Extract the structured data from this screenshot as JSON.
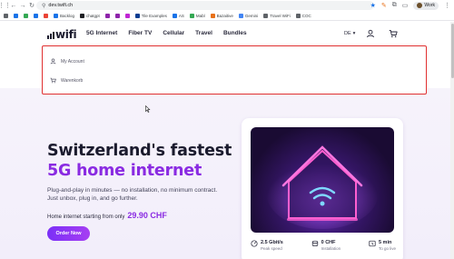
{
  "browser": {
    "url": "dev.twifi.ch",
    "profile_label": "Work",
    "bookmarks": [
      {
        "label": "",
        "color": "#5f6368"
      },
      {
        "label": "",
        "color": "#1a73e8"
      },
      {
        "label": "",
        "color": "#34a853"
      },
      {
        "label": "",
        "color": "#1a73e8"
      },
      {
        "label": "",
        "color": "#ea4335"
      },
      {
        "label": "Backlog",
        "color": "#1a73e8"
      },
      {
        "label": "chatgpt",
        "color": "#202124"
      },
      {
        "label": "",
        "color": "#8e24aa"
      },
      {
        "label": "",
        "color": "#8e24aa"
      },
      {
        "label": "",
        "color": "#c026d3"
      },
      {
        "label": "Tile Examples",
        "color": "#0b3d91"
      },
      {
        "label": "AS",
        "color": "#1a73e8"
      },
      {
        "label": "Mabl",
        "color": "#34a853"
      },
      {
        "label": "Bazaitive",
        "color": "#e8711a"
      },
      {
        "label": "Gemini",
        "color": "#4285f4"
      },
      {
        "label": "Travel WiFi",
        "color": "#5f6368"
      },
      {
        "label": "COC",
        "color": "#5f6368"
      }
    ]
  },
  "header": {
    "logo_text": "wifi",
    "nav": [
      "5G Internet",
      "Fiber TV",
      "Cellular",
      "Travel",
      "Bundles"
    ],
    "language": "DE"
  },
  "dropdown": {
    "items": [
      {
        "label": "My Account",
        "icon": "user-icon"
      },
      {
        "label": "Warenkorb",
        "icon": "cart-icon"
      }
    ]
  },
  "hero": {
    "title_line1": "Switzerland's fastest",
    "title_line2": "5G home internet",
    "subtitle": "Plug-and-play in minutes — no installation, no minimum contract. Just unbox, plug in, and go further.",
    "price_prefix": "Home internet starting from only",
    "price": "29.90 CHF",
    "cta": "Order Now"
  },
  "card": {
    "stats": [
      {
        "value": "2.5 Gbit/s",
        "label": "Peak speed",
        "icon": "speed-icon"
      },
      {
        "value": "0 CHF",
        "label": "Installation",
        "icon": "coin-icon"
      },
      {
        "value": "5 min",
        "label": "To go live",
        "icon": "timer-icon"
      }
    ]
  },
  "colors": {
    "accent": "#8a2be2",
    "highlight_border": "#e03030",
    "dark": "#1b1b2e"
  }
}
